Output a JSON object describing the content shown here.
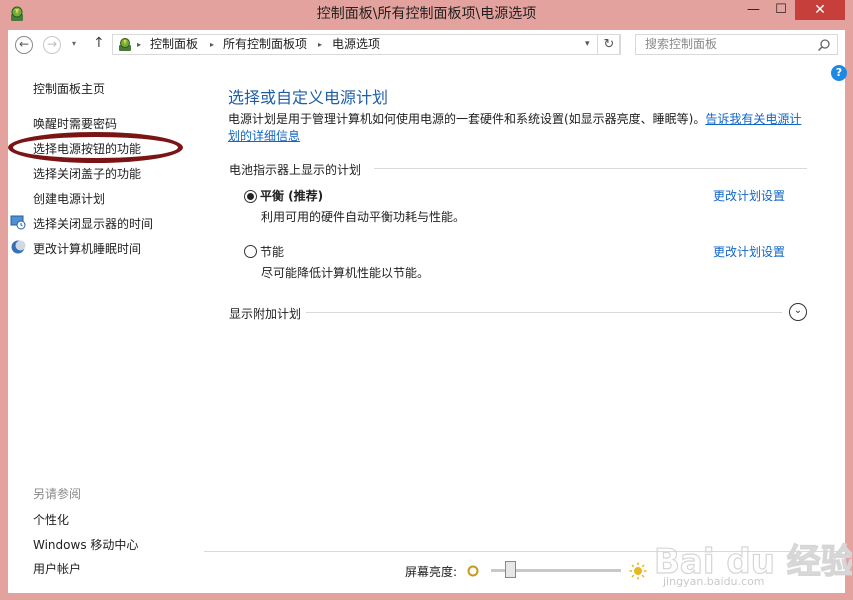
{
  "window": {
    "title": "控制面板\\所有控制面板项\\电源选项",
    "minimize_symbol": "—",
    "maximize_symbol": "☐",
    "close_symbol": "✕"
  },
  "nav": {
    "breadcrumbs": [
      "控制面板",
      "所有控制面板项",
      "电源选项"
    ],
    "search_placeholder": "搜索控制面板",
    "back_symbol": "←",
    "forward_symbol": "→",
    "up_symbol": "↑",
    "refresh_symbol": "↻",
    "dropdown_symbol": "▾",
    "breadcrumb_separator": "▸"
  },
  "help": {
    "symbol": "?"
  },
  "sidebar": {
    "home": "控制面板主页",
    "items": [
      "唤醒时需要密码",
      "选择电源按钮的功能",
      "选择关闭盖子的功能",
      "创建电源计划",
      "选择关闭显示器的时间",
      "更改计算机睡眠时间"
    ],
    "see_also_title": "另请参阅",
    "see_also": [
      "个性化",
      "Windows 移动中心",
      "用户帐户"
    ]
  },
  "main": {
    "title": "选择或自定义电源计划",
    "description": "电源计划是用于管理计算机如何使用电源的一套硬件和系统设置(如显示器亮度、睡眠等)。",
    "description_link": "告诉我有关电源计划的详细信息",
    "battery_group_label": "电池指示器上显示的计划",
    "plans": [
      {
        "name": "平衡 (推荐)",
        "desc": "利用可用的硬件自动平衡功耗与性能。",
        "link": "更改计划设置",
        "selected": true
      },
      {
        "name": "节能",
        "desc": "尽可能降低计算机性能以节能。",
        "link": "更改计划设置",
        "selected": false
      }
    ],
    "additional_plans_label": "显示附加计划",
    "expand_symbol": "⌄"
  },
  "brightness": {
    "label": "屏幕亮度:",
    "level": 0.15
  },
  "colors": {
    "title_bar": "#e4a29e",
    "link": "#1266c5",
    "title_text": "#1f5fa6",
    "close_button": "#c63f3a",
    "highlight_ellipse": "#7b1515"
  },
  "icons": {
    "app": "power-options-icon",
    "search": "search-icon",
    "help": "help-icon",
    "display_timer": "display-clock-icon",
    "sleep": "moon-icon",
    "dim": "dim-sun-icon",
    "bright": "bright-sun-icon"
  },
  "watermark": {
    "brand": "Bai du 经验",
    "url": "jingyan.baidu.com"
  }
}
